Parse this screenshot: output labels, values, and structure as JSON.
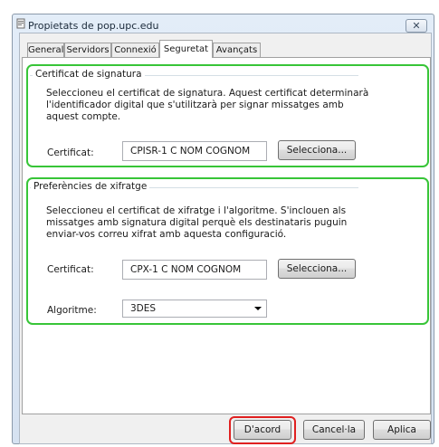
{
  "window": {
    "title": "Propietats de pop.upc.edu",
    "close_glyph": "✕"
  },
  "tabs": [
    {
      "label": "General"
    },
    {
      "label": "Servidors"
    },
    {
      "label": "Connexió"
    },
    {
      "label": "Seguretat"
    },
    {
      "label": "Avançats"
    }
  ],
  "selected_tab": "Seguretat",
  "signing": {
    "title": "Certificat de signatura",
    "description": "Seleccioneu el certificat de signatura. Aquest certificat determinarà l'identificador digital que s'utilitzarà per signar missatges amb aquest compte.",
    "certificate_label": "Certificat:",
    "certificate_value": "CPISR-1 C NOM COGNOM",
    "select_button": "Selecciona..."
  },
  "encryption": {
    "title": "Preferències de xifratge",
    "description": "Seleccioneu el certificat de xifratge i l'algoritme. S'inclouen als missatges amb signatura digital perquè els destinataris puguin enviar-vos correu xifrat amb aquesta configuració.",
    "certificate_label": "Certificat:",
    "certificate_value": "CPX-1 C NOM COGNOM",
    "select_button": "Selecciona...",
    "algorithm_label": "Algoritme:",
    "algorithm_value": "3DES"
  },
  "footer": {
    "ok": "D'acord",
    "cancel": "Cancel·la",
    "apply": "Aplica"
  },
  "colors": {
    "highlight_green": "#38c538",
    "highlight_red": "#e02020"
  },
  "icons": [
    "account-properties-icon",
    "close-icon",
    "chevron-down-icon"
  ]
}
